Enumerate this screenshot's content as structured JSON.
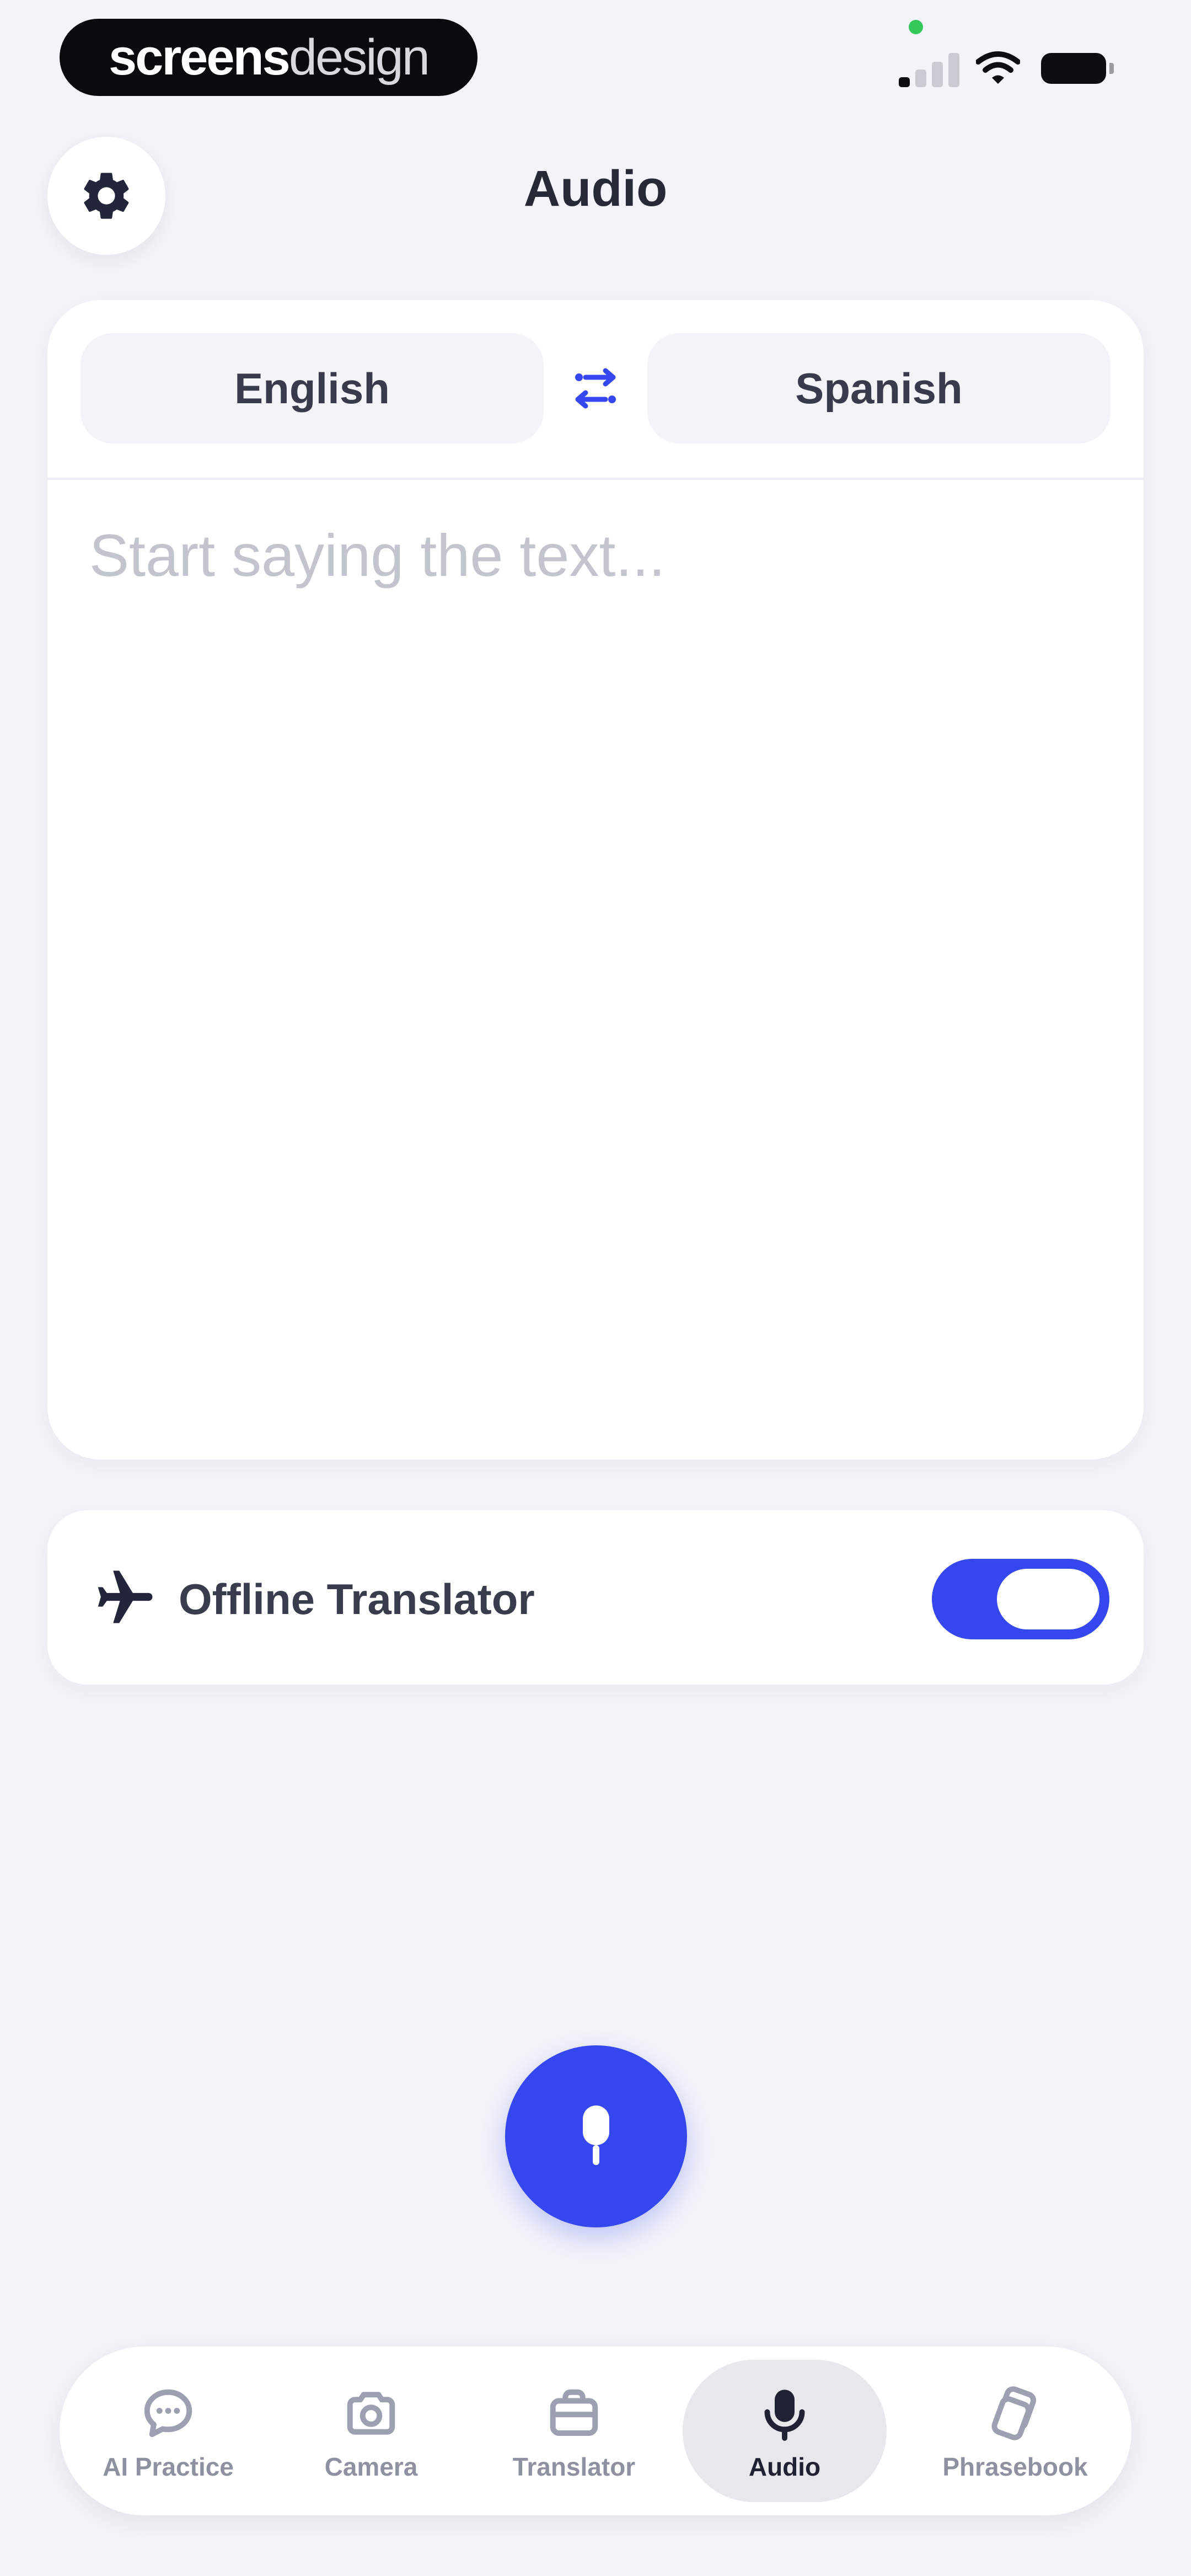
{
  "status_bar": {
    "brand_bold": "screens",
    "brand_light": "design",
    "icons": [
      "cellular-signal-icon",
      "wifi-icon",
      "battery-icon"
    ]
  },
  "header": {
    "title": "Audio",
    "settings_icon": "gear-icon"
  },
  "translator": {
    "source_language": "English",
    "target_language": "Spanish",
    "swap_icon": "swap-arrows-icon",
    "input_placeholder": "Start saying the text...",
    "input_value": ""
  },
  "offline": {
    "label": "Offline Translator",
    "icon": "airplane-icon",
    "enabled": true
  },
  "mic": {
    "icon": "microphone-icon"
  },
  "tabs": [
    {
      "label": "AI Practice",
      "icon": "chat-bubble-icon",
      "active": false
    },
    {
      "label": "Camera",
      "icon": "camera-icon",
      "active": false
    },
    {
      "label": "Translator",
      "icon": "translator-icon",
      "active": false
    },
    {
      "label": "Audio",
      "icon": "microphone-icon",
      "active": true
    },
    {
      "label": "Phrasebook",
      "icon": "phrasebook-icon",
      "active": false
    }
  ],
  "colors": {
    "accent": "#3547EE",
    "background": "#F3F4F9",
    "card": "#FFFFFF",
    "text_primary": "#262938",
    "text_muted": "#8E91A2",
    "placeholder": "#C3C5CE"
  }
}
